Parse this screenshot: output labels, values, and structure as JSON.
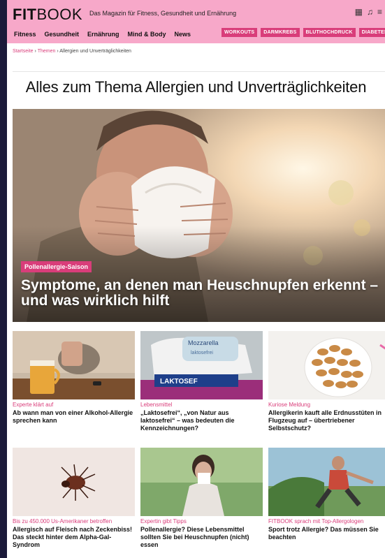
{
  "header": {
    "logo_bold": "FIT",
    "logo_thin": "BOOK",
    "tagline": "Das Magazin für Fitness, Gesundheit und Ernährung",
    "nav": [
      "Fitness",
      "Gesundheit",
      "Ernährung",
      "Mind & Body",
      "News"
    ],
    "chips": [
      "WORKOUTS",
      "DARMKREBS",
      "BLUTHOCHDRUCK",
      "DIABETES MELLITUS TYP"
    ]
  },
  "breadcrumb": {
    "home": "Startseite",
    "sep1": " › ",
    "topics": "Themen",
    "sep2": " › ",
    "current": "Allergien und Unverträglichkeiten"
  },
  "page_title": "Alles zum Thema Allergien und Unverträglichkeiten",
  "hero": {
    "kicker": "Pollenallergie-Saison",
    "title": "Symptome, an denen man Heuschnupfen erkennt – und was wirklich hilft"
  },
  "cards": [
    {
      "kicker": "Experte klärt auf",
      "title": "Ab wann man von einer Alkohol-Allergie sprechen kann"
    },
    {
      "kicker": "Lebensmittel",
      "title": "„Laktosefrei“, „von Natur aus laktosefrei“ – was bedeuten die Kennzeichnungen?"
    },
    {
      "kicker": "Kuriose Meldung",
      "title": "Allergikerin kauft alle Erdnusstüten in Flugzeug auf – übertriebener Selbstschutz?"
    },
    {
      "kicker": "Bis zu 450.000 Us-Amerikaner betroffen",
      "title": "Allergisch auf Fleisch nach Zeckenbiss! Das steckt hinter dem Alpha-Gal-Syndrom"
    },
    {
      "kicker": "Expertin gibt Tipps",
      "title": "Pollenallergie? Diese Lebensmittel sollten Sie bei Heuschnupfen (nicht) essen"
    },
    {
      "kicker": "FITBOOK sprach mit Top-Allergologen",
      "title": "Sport trotz Allergie? Das müssen Sie beachten"
    }
  ],
  "images": {
    "card2_text_a": "Mozzarella",
    "card2_text_b": "laktosefrei",
    "card2_text_c": "LAKTOSEF"
  },
  "colors": {
    "accent": "#d93d7a",
    "header_bg": "#f7a8c9",
    "frame_bg": "#1b1a3a"
  }
}
